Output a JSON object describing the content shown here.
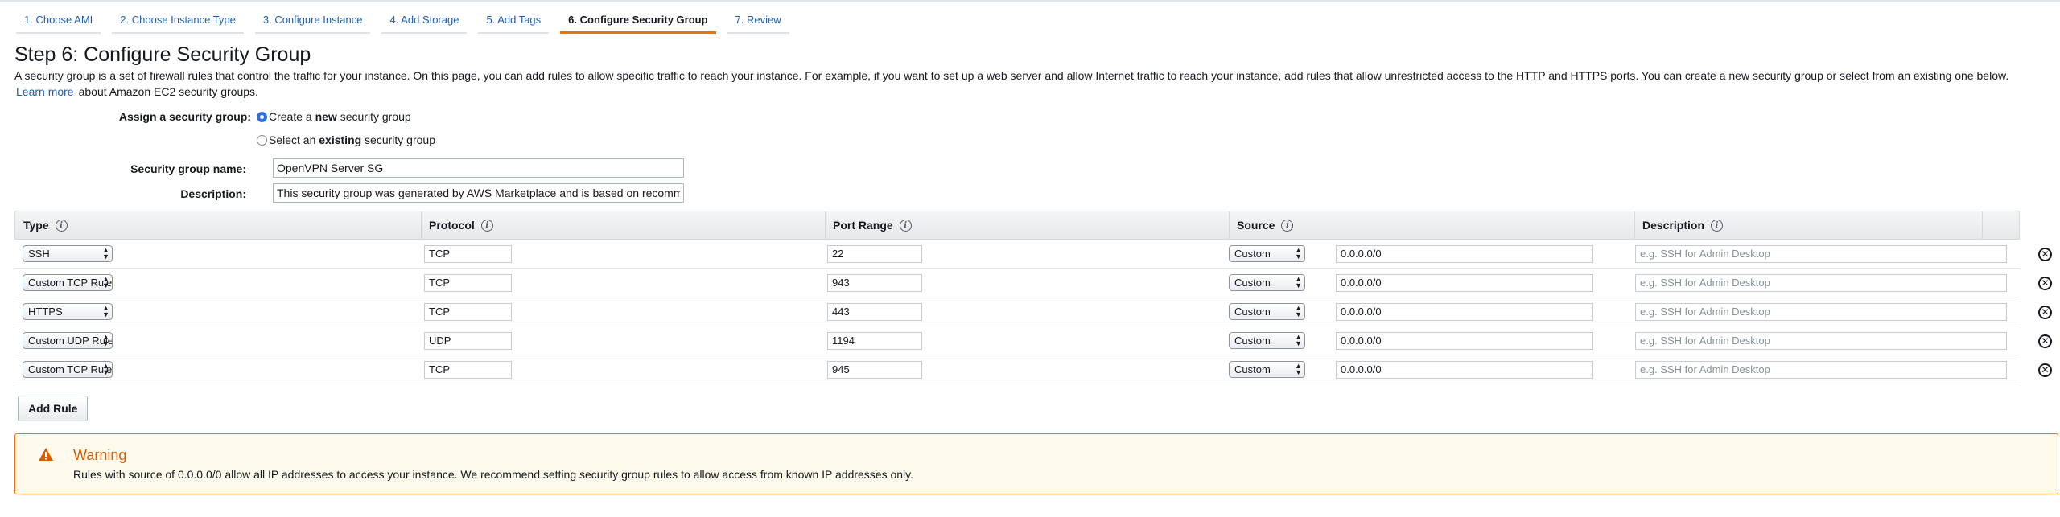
{
  "tabs": [
    {
      "label": "1. Choose AMI"
    },
    {
      "label": "2. Choose Instance Type"
    },
    {
      "label": "3. Configure Instance"
    },
    {
      "label": "4. Add Storage"
    },
    {
      "label": "5. Add Tags"
    },
    {
      "label": "6. Configure Security Group",
      "active": true
    },
    {
      "label": "7. Review"
    }
  ],
  "page": {
    "title": "Step 6: Configure Security Group",
    "intro": "A security group is a set of firewall rules that control the traffic for your instance. On this page, you can add rules to allow specific traffic to reach your instance. For example, if you want to set up a web server and allow Internet traffic to reach your instance, add rules that allow unrestricted access to the HTTP and HTTPS ports. You can create a new security group or select from an existing one below.",
    "learn_more": "Learn more",
    "learn_more_suffix": "about Amazon EC2 security groups."
  },
  "assign": {
    "label": "Assign a security group:",
    "option_new_pre": "Create a ",
    "option_new_bold": "new",
    "option_new_post": " security group",
    "option_existing_pre": "Select an ",
    "option_existing_bold": "existing",
    "option_existing_post": " security group",
    "selected": "new"
  },
  "group_name": {
    "label": "Security group name:",
    "value": "OpenVPN Server SG"
  },
  "description": {
    "label": "Description:",
    "value": "This security group was generated by AWS Marketplace and is based on recommended settings for OpenVPN Access Server"
  },
  "table": {
    "headers": {
      "type": "Type",
      "protocol": "Protocol",
      "port_range": "Port Range",
      "source": "Source",
      "description": "Description"
    },
    "rows": [
      {
        "type": "SSH",
        "protocol": "TCP",
        "port": "22",
        "source_mode": "Custom",
        "source_cidr": "0.0.0.0/0",
        "desc_placeholder": "e.g. SSH for Admin Desktop"
      },
      {
        "type": "Custom TCP Rule",
        "protocol": "TCP",
        "port": "943",
        "source_mode": "Custom",
        "source_cidr": "0.0.0.0/0",
        "desc_placeholder": "e.g. SSH for Admin Desktop"
      },
      {
        "type": "HTTPS",
        "protocol": "TCP",
        "port": "443",
        "source_mode": "Custom",
        "source_cidr": "0.0.0.0/0",
        "desc_placeholder": "e.g. SSH for Admin Desktop"
      },
      {
        "type": "Custom UDP Rule",
        "protocol": "UDP",
        "port": "1194",
        "source_mode": "Custom",
        "source_cidr": "0.0.0.0/0",
        "desc_placeholder": "e.g. SSH for Admin Desktop"
      },
      {
        "type": "Custom TCP Rule",
        "protocol": "TCP",
        "port": "945",
        "source_mode": "Custom",
        "source_cidr": "0.0.0.0/0",
        "desc_placeholder": "e.g. SSH for Admin Desktop"
      }
    ]
  },
  "add_rule_label": "Add Rule",
  "warning": {
    "title": "Warning",
    "text": "Rules with source of 0.0.0.0/0 allow all IP addresses to access your instance. We recommend setting security group rules to allow access from known IP addresses only."
  },
  "colors": {
    "accent": "#ec7211",
    "link": "#1f5fa9",
    "radio": "#2f6ee2",
    "warning_bg": "#fefaeb"
  },
  "icons": {
    "info": "info-icon",
    "remove": "remove-circle-icon",
    "warning": "warning-triangle-icon",
    "select_caret": "chevron-updown-icon"
  }
}
